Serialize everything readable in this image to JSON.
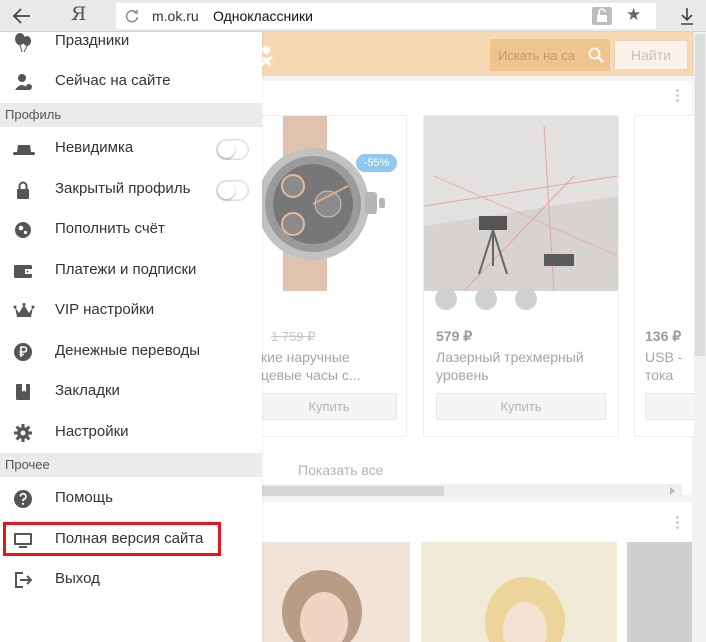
{
  "browser": {
    "logo": "Я",
    "address_domain": "m.ok.ru",
    "address_title": "Одноклассники"
  },
  "page": {
    "search_placeholder": "Искать на са",
    "search_button": "Найти",
    "products": [
      {
        "discount": "-55%",
        "price": "₽",
        "old_price": "1 759 ₽",
        "name_line1": "кие наручные",
        "name_line2": "цевые часы с...",
        "buy": "Купить"
      },
      {
        "price": "579 ₽",
        "name_line1": "Лазерный трехмерный",
        "name_line2": "уровень",
        "buy": "Купить"
      },
      {
        "price": "136 ₽",
        "name_line1": "USB -",
        "name_line2": "тока"
      }
    ],
    "show_all": "Показать все"
  },
  "menu": {
    "top_items": [
      {
        "label": "Праздники",
        "icon": "balloons-icon"
      },
      {
        "label": "Сейчас на сайте",
        "icon": "user-online-icon"
      }
    ],
    "section_profile": "Профиль",
    "profile_items": [
      {
        "label": "Невидимка",
        "icon": "hat-icon",
        "toggle": false
      },
      {
        "label": "Закрытый профиль",
        "icon": "lock-icon",
        "toggle": false
      },
      {
        "label": "Пополнить счёт",
        "icon": "coin-icon"
      },
      {
        "label": "Платежи и подписки",
        "icon": "wallet-icon"
      },
      {
        "label": "VIP настройки",
        "icon": "crown-icon"
      },
      {
        "label": "Денежные переводы",
        "icon": "ruble-icon"
      },
      {
        "label": "Закладки",
        "icon": "bookmark-icon"
      },
      {
        "label": "Настройки",
        "icon": "gear-icon"
      }
    ],
    "section_other": "Прочее",
    "other_items": [
      {
        "label": "Помощь",
        "icon": "help-icon"
      },
      {
        "label": "Полная версия сайта",
        "icon": "monitor-icon"
      },
      {
        "label": "Выход",
        "icon": "logout-icon"
      }
    ]
  },
  "colors": {
    "highlight": "#e5161b",
    "ok_orange_dimmed": "#f6d9b3",
    "discount_badge": "#8fc7f0"
  }
}
